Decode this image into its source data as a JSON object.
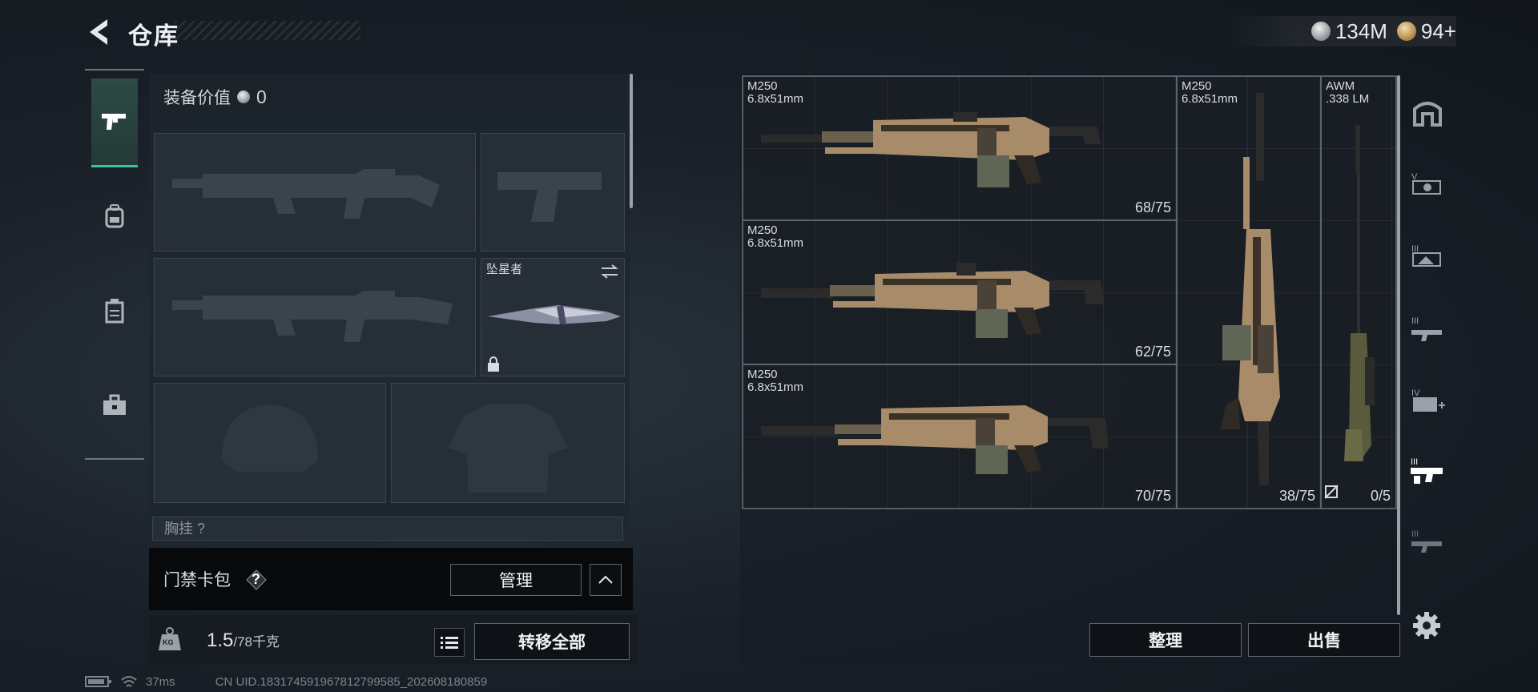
{
  "header": {
    "title": "仓库",
    "currency": [
      {
        "icon": "silver-coin-icon",
        "amount": "134M"
      },
      {
        "icon": "gold-coin-icon",
        "amount": "94+"
      }
    ]
  },
  "left_tabs": [
    {
      "name": "pistol-icon",
      "active": true
    },
    {
      "name": "backpack-icon",
      "active": false
    },
    {
      "name": "chest-rig-icon",
      "active": false
    },
    {
      "name": "toolbox-icon",
      "active": false
    }
  ],
  "equipment": {
    "value_label": "装备价值",
    "value": "0",
    "melee_name": "坠星者",
    "chest_label": "胸挂",
    "chest_count": "?"
  },
  "keycard": {
    "label": "门禁卡包",
    "help": "?",
    "manage": "管理"
  },
  "weight": {
    "unit_icon": "KG",
    "current": "1.5",
    "max_unit": "/78千克",
    "transfer_all": "转移全部"
  },
  "inventory": {
    "items": [
      {
        "name": "M250",
        "ammo_type": "6.8x51mm",
        "ammo": "68/75"
      },
      {
        "name": "M250",
        "ammo_type": "6.8x51mm",
        "ammo": "62/75"
      },
      {
        "name": "M250",
        "ammo_type": "6.8x51mm",
        "ammo": "70/75"
      },
      {
        "name": "M250",
        "ammo_type": "6.8x51mm",
        "ammo": "38/75"
      },
      {
        "name": "AWM",
        "ammo_type": ".338 LM",
        "ammo": "0/5"
      }
    ],
    "sort": "整理",
    "sell": "出售"
  },
  "status": {
    "ping": "37ms",
    "uid": "CN UID.183174591967812799585_202608180859"
  },
  "colors": {
    "accent_green": "#38c79a",
    "weapon_tan": "#a88c6a"
  }
}
